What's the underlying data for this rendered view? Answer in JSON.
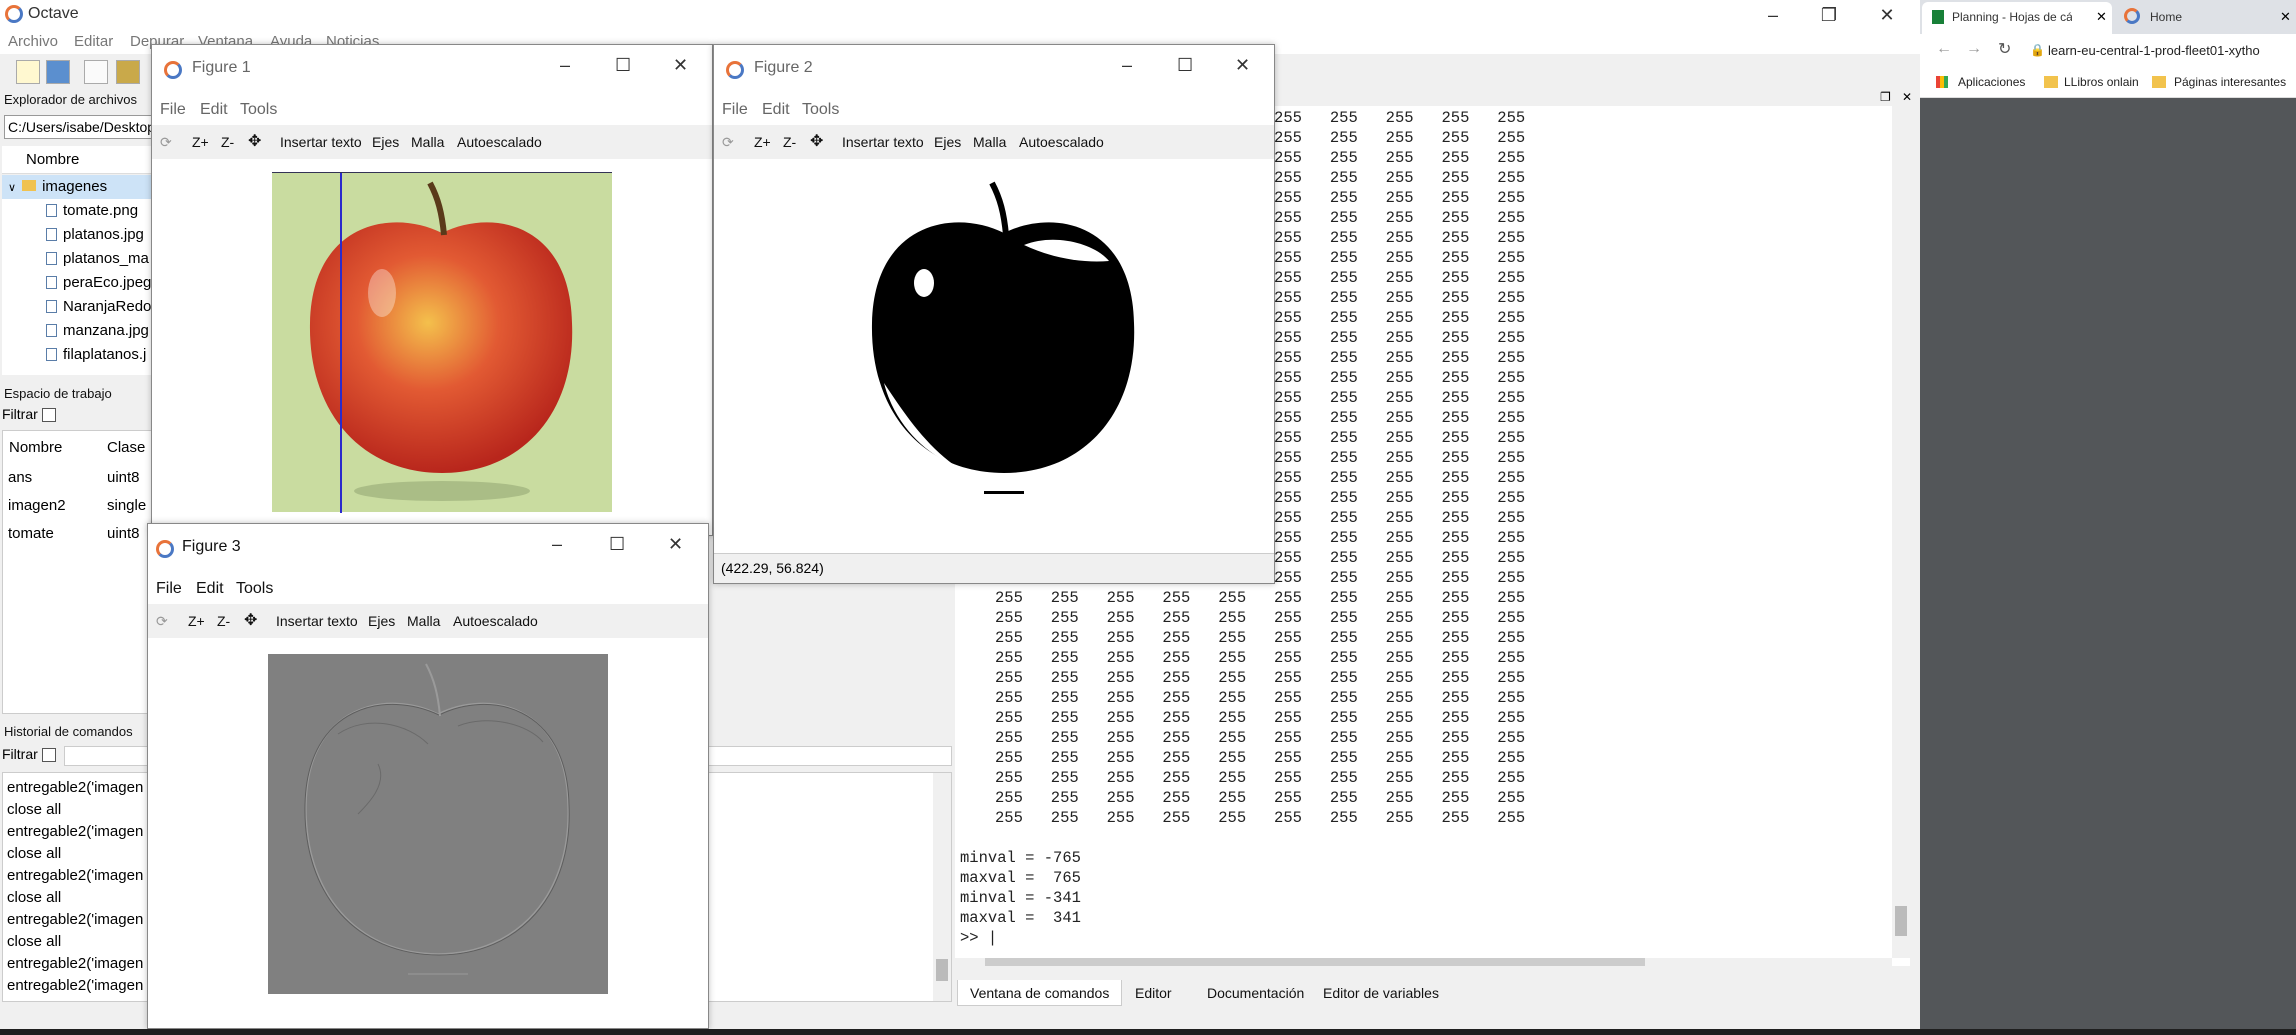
{
  "octave": {
    "title": "Octave",
    "menu": [
      "Archivo",
      "Editar",
      "Depurar",
      "Ventana",
      "Ayuda",
      "Noticias"
    ],
    "file_browser": {
      "title": "Explorador de archivos",
      "path": "C:/Users/isabe/Desktop/u",
      "column": "Nombre",
      "folder": "imagenes",
      "files": [
        "tomate.png",
        "platanos.jpg",
        "platanos_ma",
        "peraEco.jpeg",
        "NaranjaRedo",
        "manzana.jpg",
        "filaplatanos.j"
      ]
    },
    "workspace": {
      "title": "Espacio de trabajo",
      "filter_label": "Filtrar",
      "col_name": "Nombre",
      "col_class": "Clase",
      "rows": [
        {
          "name": "ans",
          "class": "uint8"
        },
        {
          "name": "imagen2",
          "class": "single"
        },
        {
          "name": "tomate",
          "class": "uint8"
        }
      ]
    },
    "history": {
      "title": "Historial de comandos",
      "filter_label": "Filtrar",
      "items": [
        "entregable2('imagen",
        "close all",
        "entregable2('imagen",
        "close all",
        "entregable2('imagen",
        "close all",
        "entregable2('imagen",
        "close all",
        "entregable2('imagen",
        "entregable2('imagen"
      ]
    },
    "command_window": {
      "matrix_value": "255",
      "output": "minval = -765\nmaxval =  765\nminval = -341\nmaxval =  341\n>> |"
    },
    "bottom_tabs": [
      "Ventana de comandos",
      "Editor",
      "Documentación",
      "Editor de variables"
    ]
  },
  "figures": {
    "menu": [
      "File",
      "Edit",
      "Tools"
    ],
    "tools": [
      "Z+",
      "Z-",
      "Insertar texto",
      "Ejes",
      "Malla",
      "Autoescalado"
    ],
    "fig1_title": "Figure 1",
    "fig2_title": "Figure 2",
    "fig3_title": "Figure 3",
    "fig2_status": "(422.29, 56.824)"
  },
  "chrome": {
    "tabs": [
      "Planning - Hojas de cá",
      "Home"
    ],
    "url": "learn-eu-central-1-prod-fleet01-xytho",
    "bookmarks": [
      "Aplicaciones",
      "LLibros onlain",
      "Páginas interesantes"
    ]
  },
  "colors": {
    "apple_bg": "#c9dca0",
    "gray_bg": "#808080",
    "octave_orange": "#e8733a",
    "octave_blue": "#4a78c4"
  }
}
